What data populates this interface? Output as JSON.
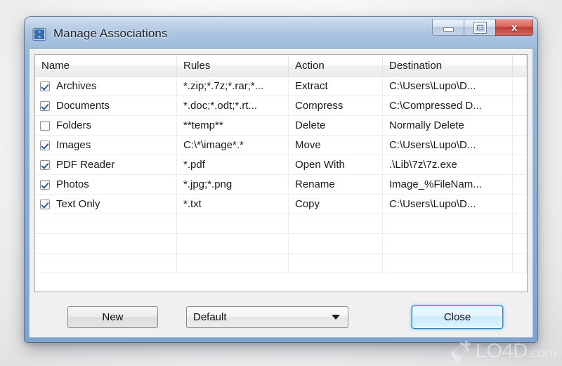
{
  "window": {
    "title": "Manage Associations",
    "app_icon": "file-cabinet-icon",
    "caption": {
      "minimize_label": "Minimize",
      "maximize_label": "Maximize",
      "close_label": "Close",
      "close_glyph": "x",
      "close_color": "#c0392b"
    }
  },
  "grid": {
    "columns": [
      "Name",
      "Rules",
      "Action",
      "Destination",
      ""
    ],
    "rows": [
      {
        "checked": true,
        "name": "Archives",
        "rules": "*.zip;*.7z;*.rar;*...",
        "action": "Extract",
        "destination": "C:\\Users\\Lupo\\D..."
      },
      {
        "checked": true,
        "name": "Documents",
        "rules": "*.doc;*.odt;*.rt...",
        "action": "Compress",
        "destination": "C:\\Compressed D..."
      },
      {
        "checked": false,
        "name": "Folders",
        "rules": "**temp**",
        "action": "Delete",
        "destination": "Normally Delete"
      },
      {
        "checked": true,
        "name": "Images",
        "rules": "C:\\*\\image*.*",
        "action": "Move",
        "destination": "C:\\Users\\Lupo\\D..."
      },
      {
        "checked": true,
        "name": "PDF Reader",
        "rules": "*.pdf",
        "action": "Open With",
        "destination": ".\\Lib\\7z\\7z.exe"
      },
      {
        "checked": true,
        "name": "Photos",
        "rules": "*.jpg;*.png",
        "action": "Rename",
        "destination": "Image_%FileNam..."
      },
      {
        "checked": true,
        "name": "Text Only",
        "rules": "*.txt",
        "action": "Copy",
        "destination": "C:\\Users\\Lupo\\D..."
      }
    ],
    "empty_row_count": 3
  },
  "footer": {
    "new_label": "New",
    "profile_value": "Default",
    "profile_options": [
      "Default"
    ],
    "close_label": "Close"
  },
  "watermark": {
    "brand": "LO4D",
    "tld": ".com",
    "logo": "circular-arrows-icon"
  }
}
